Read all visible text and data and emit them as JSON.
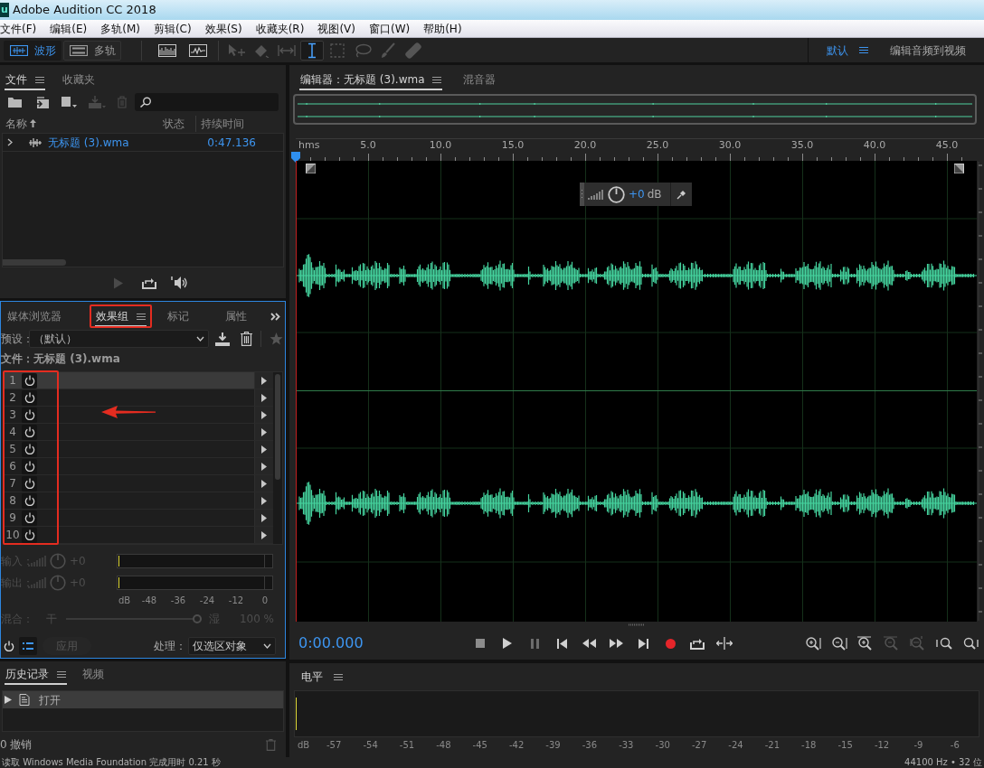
{
  "window": {
    "logo": "u",
    "title": "Adobe Audition CC 2018"
  },
  "menu": [
    "文件(F)",
    "编辑(E)",
    "多轨(M)",
    "剪辑(C)",
    "效果(S)",
    "收藏夹(R)",
    "视图(V)",
    "窗口(W)",
    "帮助(H)"
  ],
  "toolbar": {
    "modes": [
      {
        "kind": "waveform",
        "label": "波形",
        "selected": true
      },
      {
        "kind": "multitrack",
        "label": "多轨",
        "selected": false
      }
    ],
    "tools": [
      {
        "kind": "move",
        "selected": false,
        "disabled": true
      },
      {
        "kind": "razor",
        "selected": false,
        "disabled": true
      },
      {
        "kind": "slip",
        "selected": false,
        "disabled": true
      },
      {
        "kind": "time_selection",
        "selected": true,
        "disabled": false
      },
      {
        "kind": "marquee",
        "selected": false,
        "disabled": true
      },
      {
        "kind": "lasso",
        "selected": false,
        "disabled": true
      },
      {
        "kind": "brush",
        "selected": false,
        "disabled": true
      },
      {
        "kind": "spot_healing",
        "selected": false,
        "disabled": true
      }
    ],
    "workspace": {
      "label": "默认",
      "selected": true
    },
    "workspace_link": "编辑音频到视频"
  },
  "files_panel": {
    "tabs": [
      {
        "label": "文件",
        "selected": true
      },
      {
        "label": "收藏夹",
        "selected": false
      }
    ],
    "tools": [
      {
        "kind": "open",
        "disabled": false
      },
      {
        "kind": "import",
        "disabled": false
      },
      {
        "kind": "new",
        "disabled": false
      },
      {
        "kind": "insert",
        "disabled": true
      },
      {
        "kind": "delete",
        "disabled": true
      }
    ],
    "columns": [
      {
        "label": "名称",
        "sorted": true
      },
      {
        "label": "状态",
        "sorted": false
      },
      {
        "label": "持续时间",
        "sorted": false
      }
    ],
    "rows": [
      {
        "name": "无标题 (3).wma",
        "duration": "0:47.136",
        "expanded": false
      }
    ],
    "preview": [
      {
        "kind": "play",
        "disabled": true
      },
      {
        "kind": "loop",
        "disabled": false
      },
      {
        "kind": "autoplay",
        "disabled": false
      }
    ]
  },
  "effects_panel": {
    "tabs": [
      {
        "label": "媒体浏览器",
        "selected": false,
        "highlighted": false
      },
      {
        "label": "效果组",
        "selected": true,
        "highlighted": true
      },
      {
        "label": "标记",
        "selected": false,
        "highlighted": false
      },
      {
        "label": "属性",
        "selected": false,
        "highlighted": false
      }
    ],
    "preset_label": "预设：",
    "preset": "（默认）",
    "file_label": "文件：无标题 (3).wma",
    "slots": [
      {
        "number": "1",
        "selected": true
      },
      {
        "number": "2",
        "selected": false
      },
      {
        "number": "3",
        "selected": false
      },
      {
        "number": "4",
        "selected": false
      },
      {
        "number": "5",
        "selected": false
      },
      {
        "number": "6",
        "selected": false
      },
      {
        "number": "7",
        "selected": false
      },
      {
        "number": "8",
        "selected": false
      },
      {
        "number": "9",
        "selected": false
      },
      {
        "number": "10",
        "selected": false
      }
    ],
    "slots_highlighted": true,
    "arrow": true,
    "input": {
      "label": "输入：",
      "value": "+0",
      "disabled": true
    },
    "output": {
      "label": "输出：",
      "value": "+0",
      "disabled": true
    },
    "meter_scale": [
      "dB",
      "-48",
      "-36",
      "-24",
      "-12",
      "0"
    ],
    "mix": {
      "label": "混合：",
      "dry": "干",
      "wet": "湿",
      "value": "100 %",
      "level": 1,
      "disabled": true
    },
    "apply": {
      "label": "应用",
      "disabled": true
    },
    "process_label": "处理：",
    "process": "仅选区对象"
  },
  "history_panel": {
    "tabs": [
      {
        "label": "历史记录",
        "selected": true
      },
      {
        "label": "视频",
        "selected": false
      }
    ],
    "items": [
      {
        "label": "打开",
        "selected": true
      }
    ],
    "undo_count": "0 撤销"
  },
  "editor": {
    "tabs": [
      {
        "label": "编辑器：无标题 (3).wma",
        "selected": true
      },
      {
        "label": "混音器",
        "selected": false
      }
    ],
    "ruler": {
      "unit": "hms",
      "ticks": [
        "5.0",
        "10.0",
        "15.0",
        "20.0",
        "25.0",
        "30.0",
        "35.0",
        "40.0",
        "45.0"
      ]
    },
    "hud": {
      "value": "+0",
      "unit": "dB"
    },
    "time": "0:00.000",
    "zoom_tools": [
      {
        "kind": "in_amplitude",
        "disabled": false
      },
      {
        "kind": "out_amplitude",
        "disabled": false
      },
      {
        "kind": "in_time",
        "disabled": false
      },
      {
        "kind": "out_time",
        "disabled": true
      },
      {
        "kind": "full",
        "disabled": true
      },
      {
        "kind": "in_left",
        "disabled": false
      },
      {
        "kind": "in_right",
        "disabled": false
      }
    ]
  },
  "levels_panel": {
    "title": "电平",
    "scale": [
      "dB",
      "-57",
      "-54",
      "-51",
      "-48",
      "-45",
      "-42",
      "-39",
      "-36",
      "-33",
      "-30",
      "-27",
      "-24",
      "-21",
      "-18",
      "-15",
      "-12",
      "-9",
      "-6"
    ]
  },
  "status_bar": {
    "message": "读取 Windows Media Foundation 完成用时 0.21 秒",
    "format": "44100 Hz • 32 位"
  }
}
